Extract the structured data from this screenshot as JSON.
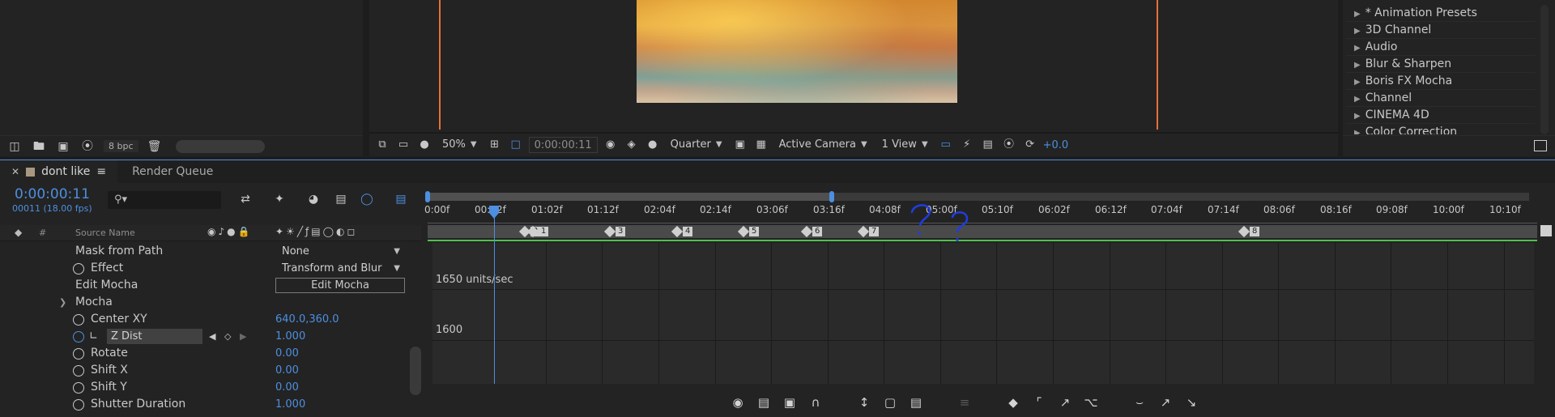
{
  "project": {
    "bpc": "8 bpc",
    "icons": [
      "interpret-footage-icon",
      "new-folder-icon",
      "new-composition-icon",
      "flowchart-icon",
      "trash-icon"
    ]
  },
  "viewer": {
    "zoom": "50%",
    "timecode": "0:00:00:11",
    "resolution": "Quarter",
    "camera": "Active Camera",
    "view_layout": "1 View",
    "exposure": "+0.0"
  },
  "effects": {
    "items": [
      {
        "label": "* Animation Presets"
      },
      {
        "label": "3D Channel"
      },
      {
        "label": "Audio"
      },
      {
        "label": "Blur & Sharpen"
      },
      {
        "label": "Boris FX Mocha"
      },
      {
        "label": "Channel"
      },
      {
        "label": "CINEMA 4D"
      },
      {
        "label": "Color Correction"
      }
    ]
  },
  "timeline": {
    "comp_tab": "dont like",
    "render_queue_tab": "Render Queue",
    "current_time": "0:00:00:11",
    "frame_info": "00011 (18.00 fps)",
    "search_placeholder": "",
    "columns": {
      "hash": "#",
      "source_name": "Source Name"
    },
    "properties": [
      {
        "name": "Mask from Path",
        "dropdown": "None"
      },
      {
        "name": "Effect",
        "dropdown": "Transform and Blur"
      },
      {
        "name": "Edit Mocha",
        "button": "Edit Mocha"
      },
      {
        "name": "Mocha"
      },
      {
        "name": "Center XY",
        "value": "640.0,360.0"
      },
      {
        "name": "Z Dist",
        "value": "1.000"
      },
      {
        "name": "Rotate",
        "value": "0.00"
      },
      {
        "name": "Shift X",
        "value": "0.00"
      },
      {
        "name": "Shift Y",
        "value": "0.00"
      },
      {
        "name": "Shutter Duration",
        "value": "1.000"
      }
    ],
    "ruler_labels": [
      "0:00f",
      "00:12f",
      "01:02f",
      "01:12f",
      "02:04f",
      "02:14f",
      "03:06f",
      "03:16f",
      "04:08f",
      "05:00f",
      "05:10f",
      "06:02f",
      "06:12f",
      "07:04f",
      "07:14f",
      "08:06f",
      "08:16f",
      "09:08f",
      "10:00f",
      "10:10f"
    ],
    "keyframe_markers": [
      "2",
      "1",
      "3",
      "4",
      "5",
      "6",
      "7",
      "8"
    ],
    "graph_labels": [
      "1650 units/sec",
      "1600"
    ]
  },
  "colors": {
    "accent": "#4d8fe0",
    "frame_lines": "#e5703a",
    "work_area_line": "#4fc04d",
    "annotation": "#1f3de0"
  }
}
